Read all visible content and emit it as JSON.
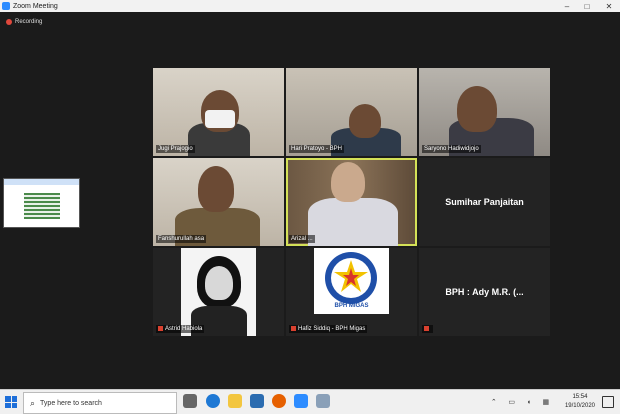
{
  "window": {
    "title": "Zoom Meeting"
  },
  "status": {
    "recording": "Recording"
  },
  "participants": [
    {
      "name": "Jugi Prajogio",
      "muted": false
    },
    {
      "name": "Hari Pratoyo - BPH",
      "muted": false
    },
    {
      "name": "Saryono Hadiwidjojo",
      "muted": false
    },
    {
      "name": "Fanshurullah asa",
      "muted": false
    },
    {
      "name": "Arizal ...",
      "muted": false,
      "active_speaker": true
    },
    {
      "name": "Sumihar Panjaitan",
      "muted": false,
      "video": false
    },
    {
      "name": "Astrid Habiola",
      "muted": true
    },
    {
      "name": "Hafiz Siddiq - BPH Migas",
      "muted": true
    },
    {
      "name": "BPH : Ady M.R. (...",
      "muted": true,
      "video": false
    }
  ],
  "logo": {
    "text": "BPH MIGAS"
  },
  "taskbar": {
    "search_placeholder": "Type here to search",
    "time": "15:54",
    "date": "19/10/2020",
    "accent": "#1e6fd9"
  }
}
